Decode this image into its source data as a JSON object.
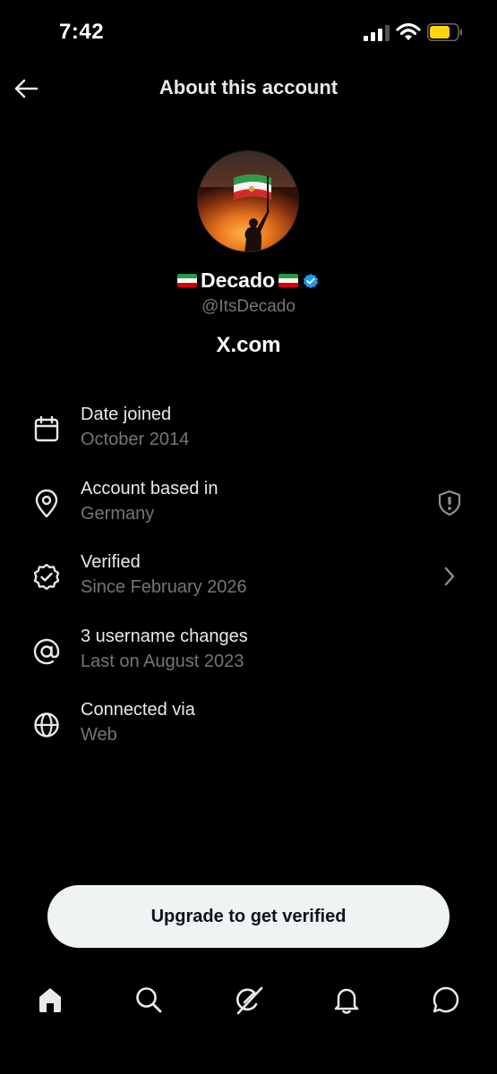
{
  "status_bar": {
    "time": "7:42",
    "battery_color": "#ffd60a"
  },
  "header": {
    "title": "About this account",
    "back_icon": "arrow-left-icon"
  },
  "profile": {
    "display_name": "Decado",
    "name_flags": "iran-lion-and-sun-flag-emoji",
    "verified_badge_color": "#1d9bf0",
    "handle": "@ItsDecado",
    "site": "X.com"
  },
  "info_items": [
    {
      "icon": "calendar-icon",
      "title": "Date joined",
      "subtitle": "October 2014"
    },
    {
      "icon": "location-pin-icon",
      "title": "Account based in",
      "subtitle": "Germany",
      "right_icon": "shield-alert-icon"
    },
    {
      "icon": "verified-badge-icon",
      "title": "Verified",
      "subtitle": "Since February 2026",
      "right_icon": "chevron-right-icon"
    },
    {
      "icon": "at-sign-icon",
      "title": "3 username changes",
      "subtitle": "Last on August 2023"
    },
    {
      "icon": "globe-icon",
      "title": "Connected via",
      "subtitle": "Web"
    }
  ],
  "upgrade_button": {
    "label": "Upgrade to get verified"
  },
  "bottom_nav": [
    {
      "icon": "home-icon",
      "active": true
    },
    {
      "icon": "search-icon"
    },
    {
      "icon": "grok-icon"
    },
    {
      "icon": "bell-icon"
    },
    {
      "icon": "chat-bubble-icon"
    }
  ],
  "colors": {
    "background": "#000000",
    "primary_text": "#e7e9ea",
    "secondary_text": "#71767b",
    "accent": "#1d9bf0"
  }
}
